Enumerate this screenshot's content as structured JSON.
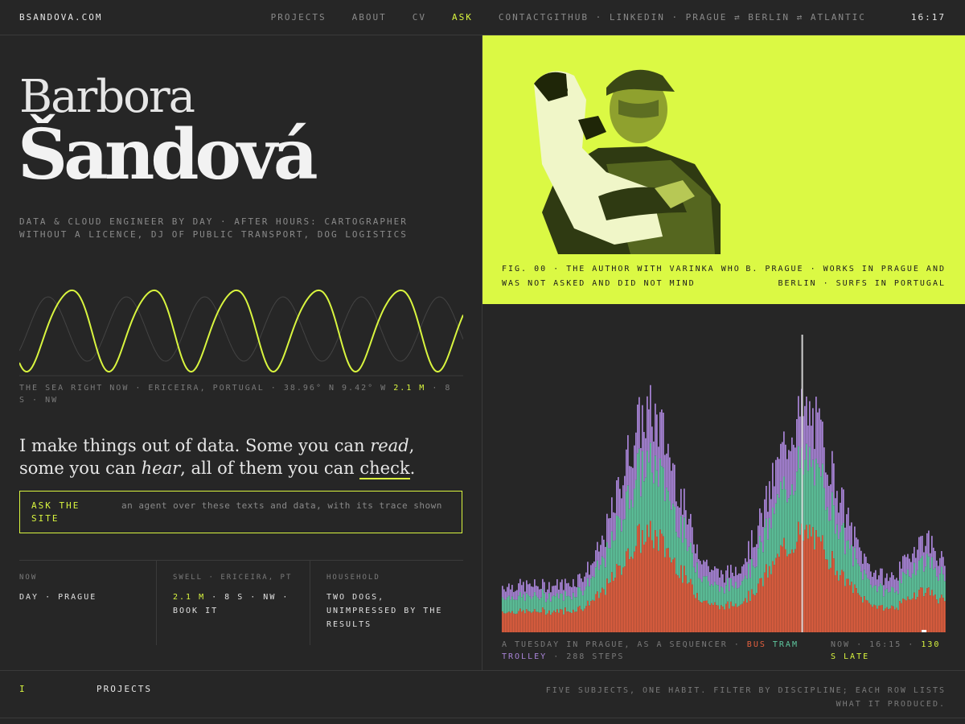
{
  "header": {
    "brand": "BSANDOVA.COM",
    "nav": [
      "PROJECTS",
      "ABOUT",
      "CV",
      "ASK",
      "CONTACT"
    ],
    "links": "GITHUB · LINKEDIN · PRAGUE ⇄ BERLIN ⇄ ATLANTIC",
    "time": "16:17"
  },
  "hero": {
    "first_name": "Barbora",
    "last_name": "Šandová",
    "tagline": "DATA & CLOUD ENGINEER BY DAY · AFTER HOURS: CARTOGRAPHER WITHOUT A LICENCE, DJ OF PUBLIC TRANSPORT, DOG LOGISTICS"
  },
  "sea": {
    "caption_prefix": "THE SEA RIGHT NOW · ERICEIRA, PORTUGAL · 38.96° N 9.42° W",
    "height": "2.1 M",
    "caption_suffix": "· 8 S · NW",
    "wave_cycles": 5.4
  },
  "intro": {
    "p1": "I make things out of data. Some you can ",
    "read": "read",
    "p2": ", some you can ",
    "hear": "hear",
    "p3": ", all of them you can ",
    "check": "check",
    "p4": "."
  },
  "ask": {
    "label": "ASK THE SITE",
    "desc": "an agent over these texts and data, with its trace shown"
  },
  "stats": {
    "now_label": "NOW",
    "now_value": "DAY · PRAGUE",
    "swell_label": "SWELL · ERICEIRA, PT",
    "swell_height": "2.1 M",
    "swell_rest": "· 8 S · NW · BOOK IT",
    "household_label": "HOUSEHOLD",
    "household_value": "TWO DOGS, UNIMPRESSED BY THE RESULTS"
  },
  "figure": {
    "caption": "FIG. 00 · THE AUTHOR WITH VARINKA WHO WAS NOT ASKED AND DID NOT MIND",
    "bio": "B. PRAGUE · WORKS IN PRAGUE AND BERLIN · SURFS IN PORTUGAL"
  },
  "sequencer": {
    "caption_prefix": "A TUESDAY IN PRAGUE, AS A SEQUENCER ·",
    "bus": "BUS",
    "tram": "TRAM",
    "trolley": "TROLLEY",
    "steps_text": "· 288 STEPS",
    "now_prefix": "NOW · 16:15 ·",
    "late": "130 S LATE"
  },
  "footer": {
    "index": "I",
    "section": "PROJECTS",
    "subtitle": "FIVE SUBJECTS, ONE HABIT. FILTER BY DISCIPLINE; EACH ROW LISTS WHAT IT PRODUCED."
  },
  "colors": {
    "accent": "#d9f53f",
    "bus": "#e5603f",
    "tram": "#5fc9a0",
    "trolley": "#a984d8",
    "background": "#262626"
  }
}
